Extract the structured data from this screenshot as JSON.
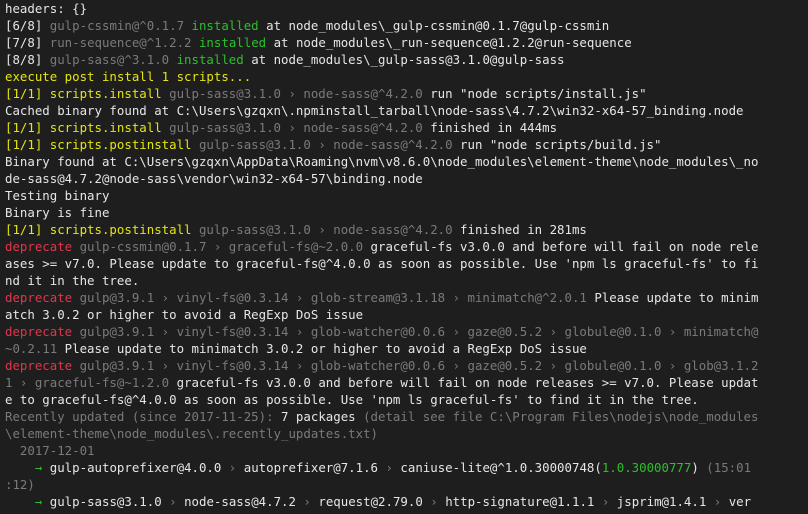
{
  "terminal": {
    "lines": [
      [
        {
          "t": "headers: {}",
          "c": "w"
        }
      ],
      [
        {
          "t": "[6/8] ",
          "c": "w"
        },
        {
          "t": "gulp-cssmin@^0.1.7",
          "c": "g"
        },
        {
          "t": " installed",
          "c": "grn"
        },
        {
          "t": " at node_modules\\_gulp-cssmin@0.1.7@gulp-cssmin",
          "c": "w"
        }
      ],
      [
        {
          "t": "[7/8] ",
          "c": "w"
        },
        {
          "t": "run-sequence@^1.2.2",
          "c": "g"
        },
        {
          "t": " installed",
          "c": "grn"
        },
        {
          "t": " at node_modules\\_run-sequence@1.2.2@run-sequence",
          "c": "w"
        }
      ],
      [
        {
          "t": "[8/8] ",
          "c": "w"
        },
        {
          "t": "gulp-sass@^3.1.0",
          "c": "g"
        },
        {
          "t": " installed",
          "c": "grn"
        },
        {
          "t": " at node_modules\\_gulp-sass@3.1.0@gulp-sass",
          "c": "w"
        }
      ],
      [
        {
          "t": "execute post install 1 scripts...",
          "c": "y"
        }
      ],
      [
        {
          "t": "[1/1] scripts.install",
          "c": "y"
        },
        {
          "t": " gulp-sass@3.1.0 › node-sass@^4.2.0",
          "c": "g"
        },
        {
          "t": " run \"node scripts/install.js\"",
          "c": "w"
        }
      ],
      [
        {
          "t": "Cached binary found at C:\\Users\\gzqxn\\.npminstall_tarball\\node-sass\\4.7.2\\win32-x64-57_binding.node",
          "c": "w"
        }
      ],
      [
        {
          "t": "[1/1] scripts.install",
          "c": "y"
        },
        {
          "t": " gulp-sass@3.1.0 › node-sass@^4.2.0",
          "c": "g"
        },
        {
          "t": " finished in 444ms",
          "c": "w"
        }
      ],
      [
        {
          "t": "[1/1] scripts.postinstall",
          "c": "y"
        },
        {
          "t": " gulp-sass@3.1.0 › node-sass@^4.2.0",
          "c": "g"
        },
        {
          "t": " run \"node scripts/build.js\"",
          "c": "w"
        }
      ],
      [
        {
          "t": "Binary found at C:\\Users\\gzqxn\\AppData\\Roaming\\nvm\\v8.6.0\\node_modules\\element-theme\\node_modules\\_no",
          "c": "w"
        }
      ],
      [
        {
          "t": "de-sass@4.7.2@node-sass\\vendor\\win32-x64-57\\binding.node",
          "c": "w"
        }
      ],
      [
        {
          "t": "Testing binary",
          "c": "w"
        }
      ],
      [
        {
          "t": "Binary is fine",
          "c": "w"
        }
      ],
      [
        {
          "t": "[1/1] scripts.postinstall",
          "c": "y"
        },
        {
          "t": " gulp-sass@3.1.0 › node-sass@^4.2.0",
          "c": "g"
        },
        {
          "t": " finished in 281ms",
          "c": "w"
        }
      ],
      [
        {
          "t": "deprecate",
          "c": "r"
        },
        {
          "t": " gulp-cssmin@0.1.7 › graceful-fs@~2.0.0",
          "c": "g"
        },
        {
          "t": " graceful-fs v3.0.0 and before will fail on node rele",
          "c": "w"
        }
      ],
      [
        {
          "t": "ases >= v7.0. Please update to graceful-fs@^4.0.0 as soon as possible. Use 'npm ls graceful-fs' to fi",
          "c": "w"
        }
      ],
      [
        {
          "t": "nd it in the tree.",
          "c": "w"
        }
      ],
      [
        {
          "t": "deprecate",
          "c": "r"
        },
        {
          "t": " gulp@3.9.1 › vinyl-fs@0.3.14 › glob-stream@3.1.18 › minimatch@^2.0.1",
          "c": "g"
        },
        {
          "t": " Please update to minim",
          "c": "w"
        }
      ],
      [
        {
          "t": "atch 3.0.2 or higher to avoid a RegExp DoS issue",
          "c": "w"
        }
      ],
      [
        {
          "t": "deprecate",
          "c": "r"
        },
        {
          "t": " gulp@3.9.1 › vinyl-fs@0.3.14 › glob-watcher@0.0.6 › gaze@0.5.2 › globule@0.1.0 › minimatch@",
          "c": "g"
        }
      ],
      [
        {
          "t": "~0.2.11",
          "c": "g"
        },
        {
          "t": " Please update to minimatch 3.0.2 or higher to avoid a RegExp DoS issue",
          "c": "w"
        }
      ],
      [
        {
          "t": "deprecate",
          "c": "r"
        },
        {
          "t": " gulp@3.9.1 › vinyl-fs@0.3.14 › glob-watcher@0.0.6 › gaze@0.5.2 › globule@0.1.0 › glob@3.1.2",
          "c": "g"
        }
      ],
      [
        {
          "t": "1 › graceful-fs@~1.2.0",
          "c": "g"
        },
        {
          "t": " graceful-fs v3.0.0 and before will fail on node releases >= v7.0. Please updat",
          "c": "w"
        }
      ],
      [
        {
          "t": "e to graceful-fs@^4.0.0 as soon as possible. Use 'npm ls graceful-fs' to find it in the tree.",
          "c": "w"
        }
      ],
      [
        {
          "t": "Recently updated (since 2017-11-25): ",
          "c": "g"
        },
        {
          "t": "7 packages",
          "c": "w"
        },
        {
          "t": " (detail see file C:\\Program Files\\nodejs\\node_modules",
          "c": "g"
        }
      ],
      [
        {
          "t": "\\element-theme\\node_modules\\.recently_updates.txt)",
          "c": "g"
        }
      ],
      [
        {
          "t": "  2017-12-01",
          "c": "g"
        }
      ],
      [
        {
          "t": "    → ",
          "c": "grn"
        },
        {
          "t": "gulp-autoprefixer@4.0.0",
          "c": "w"
        },
        {
          "t": " › ",
          "c": "g"
        },
        {
          "t": "autoprefixer@7.1.6",
          "c": "w"
        },
        {
          "t": " › ",
          "c": "g"
        },
        {
          "t": "caniuse-lite@^1.0.30000748(",
          "c": "w"
        },
        {
          "t": "1.0.30000777",
          "c": "grn"
        },
        {
          "t": ")",
          "c": "w"
        },
        {
          "t": " (15:01",
          "c": "g"
        }
      ],
      [
        {
          "t": ":12)",
          "c": "g"
        }
      ],
      [
        {
          "t": "    → ",
          "c": "grn"
        },
        {
          "t": "gulp-sass@3.1.0",
          "c": "w"
        },
        {
          "t": " › ",
          "c": "g"
        },
        {
          "t": "node-sass@4.7.2",
          "c": "w"
        },
        {
          "t": " › ",
          "c": "g"
        },
        {
          "t": "request@2.79.0",
          "c": "w"
        },
        {
          "t": " › ",
          "c": "g"
        },
        {
          "t": "http-signature@1.1.1",
          "c": "w"
        },
        {
          "t": " › ",
          "c": "g"
        },
        {
          "t": "jsprim@1.4.1",
          "c": "w"
        },
        {
          "t": " › ",
          "c": "g"
        },
        {
          "t": "ver",
          "c": "w"
        }
      ]
    ],
    "colors": {
      "background": "#1e1e1e",
      "text": "#e6e6e6",
      "dim": "#7a7a7a",
      "green": "#2bc02b",
      "yellow": "#e5e510",
      "red": "#e0354a"
    }
  }
}
